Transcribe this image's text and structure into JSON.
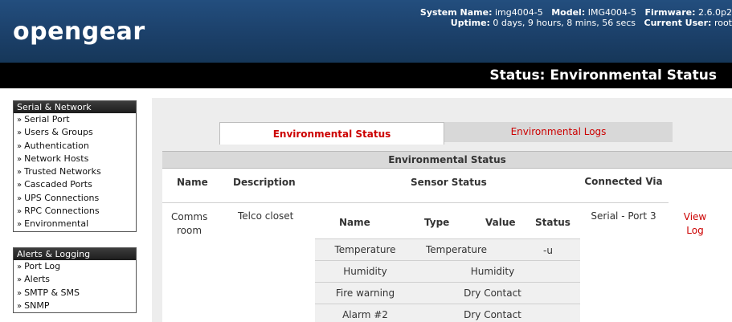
{
  "header": {
    "logo": "opengear",
    "system_name_label": "System Name:",
    "system_name": "img4004-5",
    "model_label": "Model:",
    "model": "IMG4004-5",
    "firmware_label": "Firmware:",
    "firmware": "2.6.0p2",
    "uptime_label": "Uptime:",
    "uptime": "0 days, 9 hours, 8 mins, 56 secs",
    "current_user_label": "Current User:",
    "current_user": "root"
  },
  "page_title": "Status: Environmental Status",
  "sidebar": {
    "serial_network": {
      "title": "Serial & Network",
      "items": [
        "Serial Port",
        "Users & Groups",
        "Authentication",
        "Network Hosts",
        "Trusted Networks",
        "Cascaded Ports",
        "UPS Connections",
        "RPC Connections",
        "Environmental"
      ]
    },
    "alerts_logging": {
      "title": "Alerts & Logging",
      "items": [
        "Port Log",
        "Alerts",
        "SMTP & SMS",
        "SNMP"
      ]
    },
    "arrow": "»"
  },
  "tabs": {
    "active": "Environmental Status",
    "inactive": "Environmental Logs"
  },
  "section_title": "Environmental Status",
  "table": {
    "headers": {
      "name": "Name",
      "description": "Description",
      "sensor_status": "Sensor Status",
      "connected_via": "Connected Via"
    },
    "row": {
      "name": "Comms room",
      "description": "Telco closet",
      "connected_via": "Serial - Port 3",
      "action": "View Log"
    },
    "sensor_headers": {
      "name": "Name",
      "type": "Type",
      "value": "Value",
      "status": "Status"
    },
    "sensors": [
      {
        "name": "Temperature",
        "type": "Temperature",
        "status": "-u"
      },
      {
        "name": "Humidity",
        "type": "Humidity"
      },
      {
        "name": "Fire warning",
        "type": "Dry Contact"
      },
      {
        "name": "Alarm #2",
        "type": "Dry Contact"
      }
    ]
  }
}
